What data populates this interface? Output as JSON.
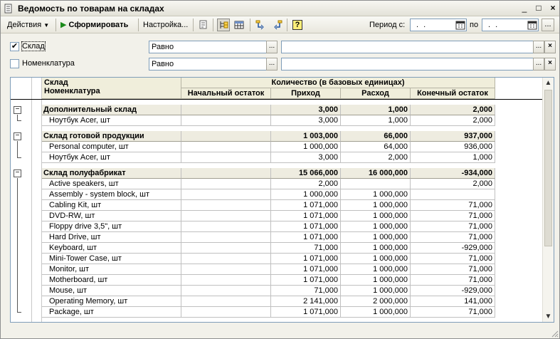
{
  "window": {
    "title": "Ведомость по товарам на складах",
    "controls": [
      "_",
      "□",
      "×"
    ]
  },
  "toolbar": {
    "actions_label": "Действия",
    "generate_label": "Сформировать",
    "settings_label": "Настройка...",
    "period_from_label": "Период с:",
    "period_to_label": "по",
    "period_from_value": ". .",
    "period_to_value": ". .",
    "help_label": "?"
  },
  "filters": [
    {
      "checked": true,
      "label": "Склад",
      "condition": "Равно",
      "value": ""
    },
    {
      "checked": false,
      "label": "Номенклатура",
      "condition": "Равно",
      "value": ""
    }
  ],
  "report": {
    "header": {
      "group_col_line1": "Склад",
      "group_col_line2": "Номенклатура",
      "quantity_title": "Количество (в базовых единицах)",
      "columns": [
        "Начальный остаток",
        "Приход",
        "Расход",
        "Конечный остаток"
      ]
    },
    "groups": [
      {
        "name": "Дополнительный склад",
        "start": "",
        "income": "3,000",
        "expense": "1,000",
        "end": "2,000",
        "items": [
          {
            "name": "Ноутбук Acer, шт",
            "start": "",
            "income": "3,000",
            "expense": "1,000",
            "end": "2,000"
          }
        ]
      },
      {
        "name": "Склад готовой продукции",
        "start": "",
        "income": "1 003,000",
        "expense": "66,000",
        "end": "937,000",
        "items": [
          {
            "name": "Personal computer, шт",
            "start": "",
            "income": "1 000,000",
            "expense": "64,000",
            "end": "936,000"
          },
          {
            "name": "Ноутбук Acer, шт",
            "start": "",
            "income": "3,000",
            "expense": "2,000",
            "end": "1,000"
          }
        ]
      },
      {
        "name": "Склад полуфабрикат",
        "start": "",
        "income": "15 066,000",
        "expense": "16 000,000",
        "end": "-934,000",
        "items": [
          {
            "name": "Active speakers, шт",
            "start": "",
            "income": "2,000",
            "expense": "",
            "end": "2,000"
          },
          {
            "name": "Assembly - system block, шт",
            "start": "",
            "income": "1 000,000",
            "expense": "1 000,000",
            "end": ""
          },
          {
            "name": "Cabling Kit, шт",
            "start": "",
            "income": "1 071,000",
            "expense": "1 000,000",
            "end": "71,000"
          },
          {
            "name": "DVD-RW, шт",
            "start": "",
            "income": "1 071,000",
            "expense": "1 000,000",
            "end": "71,000"
          },
          {
            "name": "Floppy drive 3,5\", шт",
            "start": "",
            "income": "1 071,000",
            "expense": "1 000,000",
            "end": "71,000"
          },
          {
            "name": "Hard Drive, шт",
            "start": "",
            "income": "1 071,000",
            "expense": "1 000,000",
            "end": "71,000"
          },
          {
            "name": "Keyboard, шт",
            "start": "",
            "income": "71,000",
            "expense": "1 000,000",
            "end": "-929,000"
          },
          {
            "name": "Mini-Tower Case, шт",
            "start": "",
            "income": "1 071,000",
            "expense": "1 000,000",
            "end": "71,000"
          },
          {
            "name": "Monitor, шт",
            "start": "",
            "income": "1 071,000",
            "expense": "1 000,000",
            "end": "71,000"
          },
          {
            "name": "Motherboard, шт",
            "start": "",
            "income": "1 071,000",
            "expense": "1 000,000",
            "end": "71,000"
          },
          {
            "name": "Mouse, шт",
            "start": "",
            "income": "71,000",
            "expense": "1 000,000",
            "end": "-929,000"
          },
          {
            "name": "Operating Memory, шт",
            "start": "",
            "income": "2 141,000",
            "expense": "2 000,000",
            "end": "141,000"
          },
          {
            "name": "Package, шт",
            "start": "",
            "income": "1 071,000",
            "expense": "1 000,000",
            "end": "71,000"
          }
        ]
      }
    ]
  }
}
